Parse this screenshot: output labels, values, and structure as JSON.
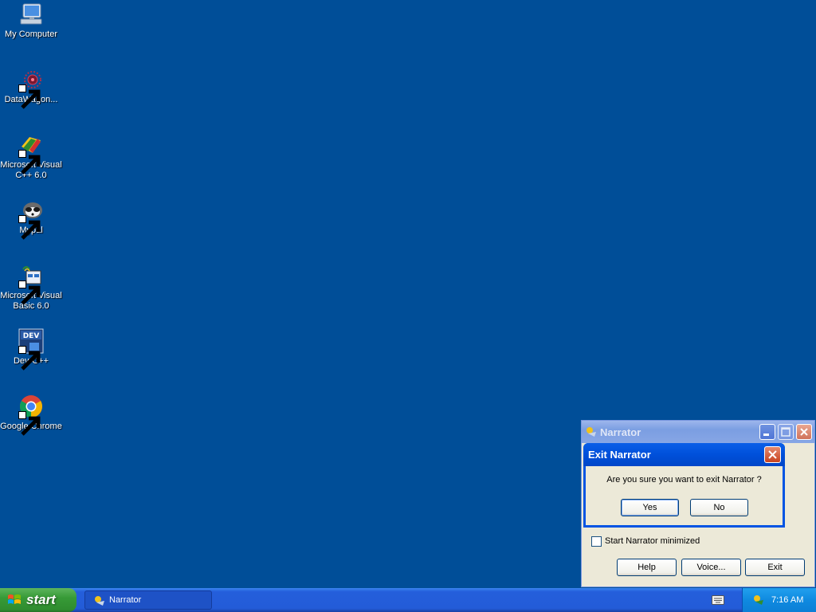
{
  "desktop": {
    "icons": [
      {
        "label": "My Computer",
        "icon": "my-computer-icon"
      },
      {
        "label": "DataWagon...",
        "icon": "datawagon-icon"
      },
      {
        "label_line1": "Microsoft Visual",
        "label_line2": "C++ 6.0",
        "icon": "visual-cpp-icon"
      },
      {
        "label": "Mypal",
        "icon": "mypal-icon"
      },
      {
        "label_line1": "Microsoft Visual",
        "label_line2": "Basic 6.0",
        "icon": "visual-basic-icon"
      },
      {
        "label": "Dev-C++",
        "icon": "dev-cpp-icon"
      },
      {
        "label": "Google Chrome",
        "icon": "chrome-icon"
      }
    ]
  },
  "narrator_window": {
    "title": "Narrator",
    "start_minimized_label": "Start Narrator minimized",
    "start_minimized_checked": false,
    "buttons": {
      "help": "Help",
      "voice": "Voice...",
      "exit": "Exit"
    }
  },
  "exit_dialog": {
    "title": "Exit Narrator",
    "message": "Are you sure you want to exit Narrator ?",
    "yes_label": "Yes",
    "no_label": "No"
  },
  "taskbar": {
    "start_label": "start",
    "task_label": "Narrator",
    "clock": "7:16 AM"
  },
  "colors": {
    "desktop_background": "#004e98",
    "dialog_titlebar": "#0054e3",
    "start_button": "#379a37"
  }
}
